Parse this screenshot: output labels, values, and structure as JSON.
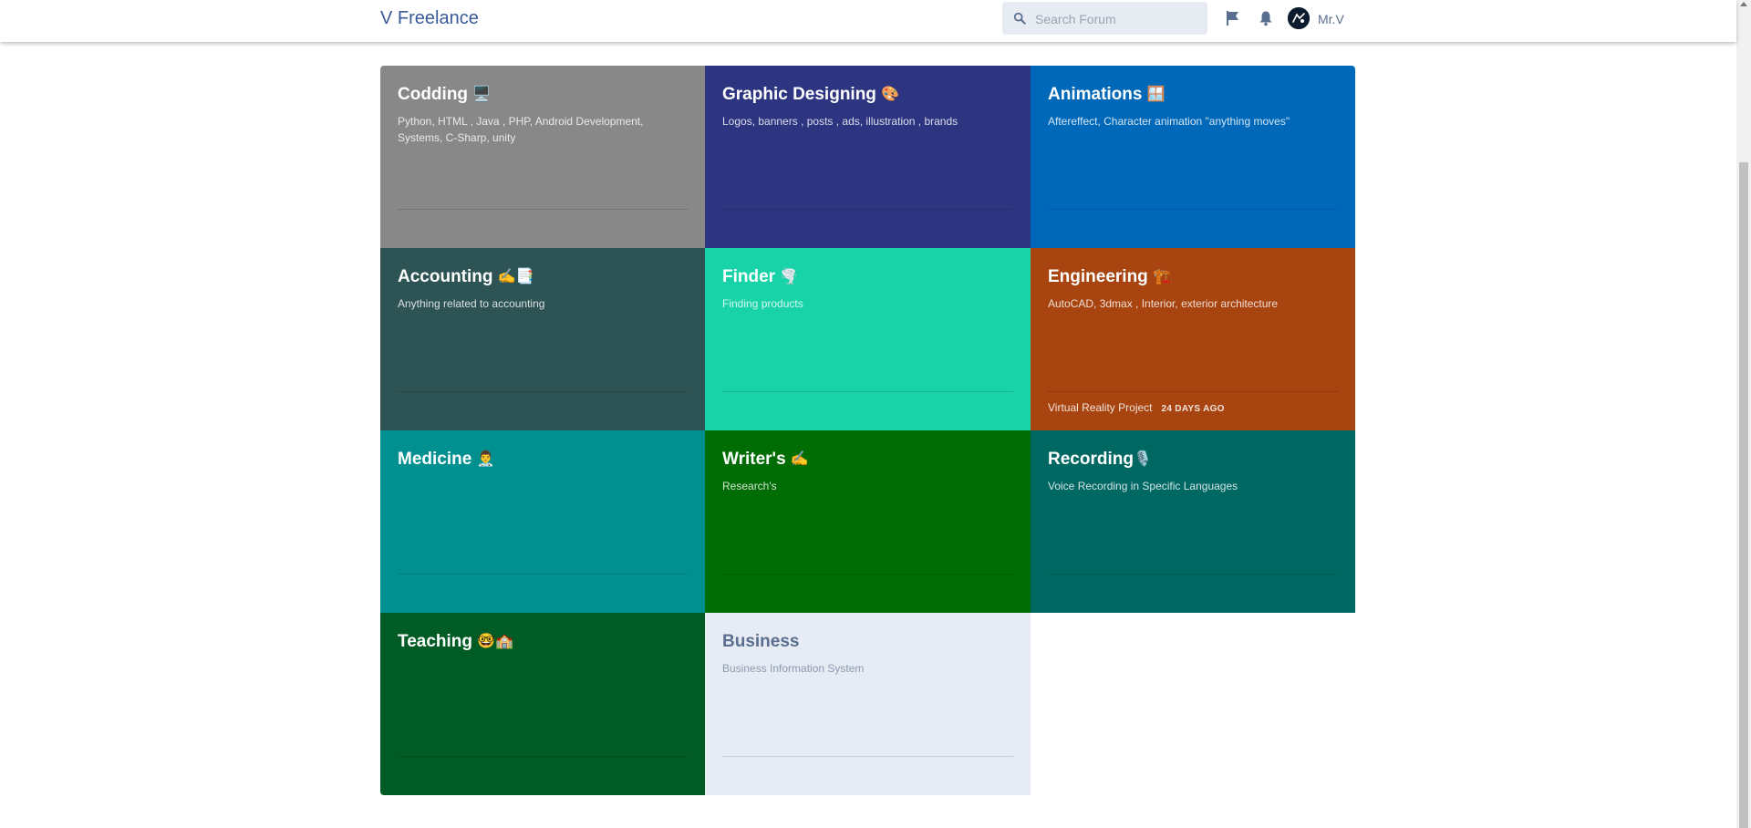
{
  "header": {
    "brand": "V Freelance",
    "search_placeholder": "Search Forum",
    "user_name": "Mr.V"
  },
  "tiles": [
    {
      "title": "Codding",
      "emoji": "🖥️",
      "desc": "Python, HTML , Java , PHP, Android Development, Systems, C-Sharp, unity",
      "color": "#888888"
    },
    {
      "title": "Graphic Designing",
      "emoji": "🎨",
      "desc": "Logos, banners , posts , ads, illustration , brands",
      "color": "#2e3580"
    },
    {
      "title": "Animations",
      "emoji": "🪟",
      "desc": "Aftereffect, Character animation \"anything moves\"",
      "color": "#0068b8"
    },
    {
      "title": "Accounting",
      "emoji": "✍️📑",
      "desc": "Anything related to accounting",
      "color": "#2e5354"
    },
    {
      "title": "Finder",
      "emoji": "🌪️",
      "desc": "Finding products",
      "color": "#18d3a8"
    },
    {
      "title": "Engineering",
      "emoji": "🏗️",
      "desc": "AutoCAD, 3dmax , Interior, exterior architecture",
      "color": "#a7440f",
      "last_post": "Virtual Reality Project",
      "last_post_time": "24 DAYS AGO"
    },
    {
      "title": "Medicine",
      "emoji": "👨‍⚕️",
      "desc": "",
      "color": "#009090"
    },
    {
      "title": "Writer's",
      "emoji": "✍️",
      "desc": "Research's",
      "color": "#006c04"
    },
    {
      "title": "Recording",
      "emoji": "🎙️",
      "desc": "Voice Recording in Specific Languages",
      "color": "#006863"
    },
    {
      "title": "Teaching",
      "emoji": "🤓🏫",
      "desc": "",
      "color": "#005b25"
    },
    {
      "title": "Business",
      "emoji": "",
      "desc": "Business Information System",
      "color": "#e7ebf3"
    }
  ]
}
